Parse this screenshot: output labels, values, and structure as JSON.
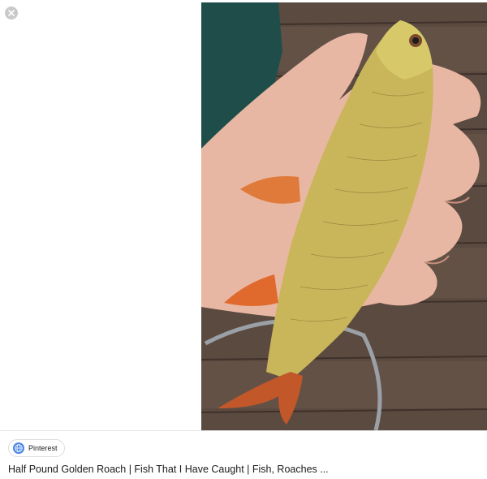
{
  "viewer": {
    "close_icon": "close-icon",
    "image_subject": "golden-roach-fish-photo"
  },
  "source": {
    "icon": "globe-icon",
    "label": "Pinterest"
  },
  "result": {
    "title": "Half Pound Golden Roach | Fish That I Have Caught | Fish, Roaches ..."
  },
  "colors": {
    "chip_border": "#dadce0",
    "globe": "#4a86e8",
    "close_bg": "#c9c9c9"
  }
}
